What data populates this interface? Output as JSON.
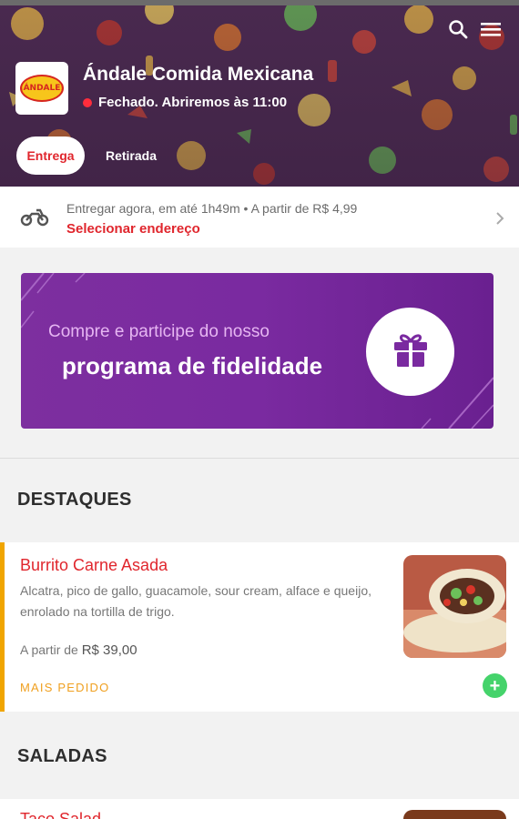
{
  "header": {
    "store_name": "Ándale Comida Mexicana",
    "status_text": "Fechado. Abriremos às 11:00",
    "logo_text": "¡ÁNDALE!",
    "tabs": [
      {
        "label": "Entrega",
        "active": true
      },
      {
        "label": "Retirada",
        "active": false
      }
    ],
    "icons": [
      "search-icon",
      "menu-icon"
    ]
  },
  "delivery": {
    "info": "Entregar agora, em até 1h49m • A partir de R$ 4,99",
    "action": "Selecionar endereço"
  },
  "banner": {
    "line1": "Compre e participe do nosso",
    "line2": "programa de fidelidade"
  },
  "sections": [
    {
      "title": "DESTAQUES",
      "products": [
        {
          "name": "Burrito Carne Asada",
          "description": "Alcatra, pico de gallo, guacamole, sour cream, alface e queijo, enrolado na tortilla de trigo.",
          "price_prefix": "A partir de",
          "price": "R$ 39,00",
          "tag": "MAIS PEDIDO"
        }
      ]
    },
    {
      "title": "SALADAS",
      "products": [
        {
          "name": "Taco Salad"
        }
      ]
    }
  ],
  "colors": {
    "accent_red": "#e0262d",
    "banner_purple": "#7a2aa0",
    "highlight_orange": "#f0a500",
    "add_green": "#45d36b"
  }
}
